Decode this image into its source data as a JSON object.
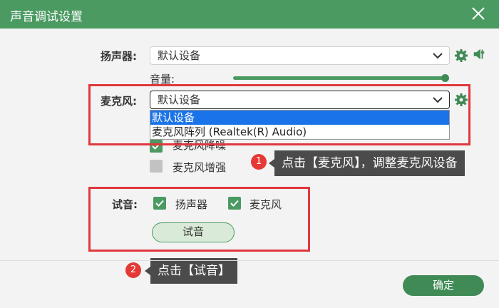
{
  "dialog": {
    "title": "声音调试设置"
  },
  "speaker": {
    "label": "扬声器:",
    "value": "默认设备"
  },
  "volume": {
    "label": "音量:",
    "level": 1.0
  },
  "mic": {
    "label": "麦克风:",
    "value": "默认设备",
    "options": [
      "默认设备",
      "麦克风阵列 (Realtek(R) Audio)"
    ]
  },
  "options": {
    "noise_reduction": {
      "label": "麦克风降噪",
      "checked": true
    },
    "boost": {
      "label": "麦克风增强",
      "checked": false
    }
  },
  "test": {
    "label": "试音:",
    "speaker_label": "扬声器",
    "mic_label": "麦克风",
    "button": "试音"
  },
  "callouts": [
    {
      "number": "1",
      "text": "点击【麦克风】，调整麦克风设备"
    },
    {
      "number": "2",
      "text": "点击【试音】"
    }
  ],
  "confirm": "确定",
  "colors": {
    "accent": "#4a9a62",
    "highlight": "#e0373d",
    "selection": "#1a73e8"
  }
}
